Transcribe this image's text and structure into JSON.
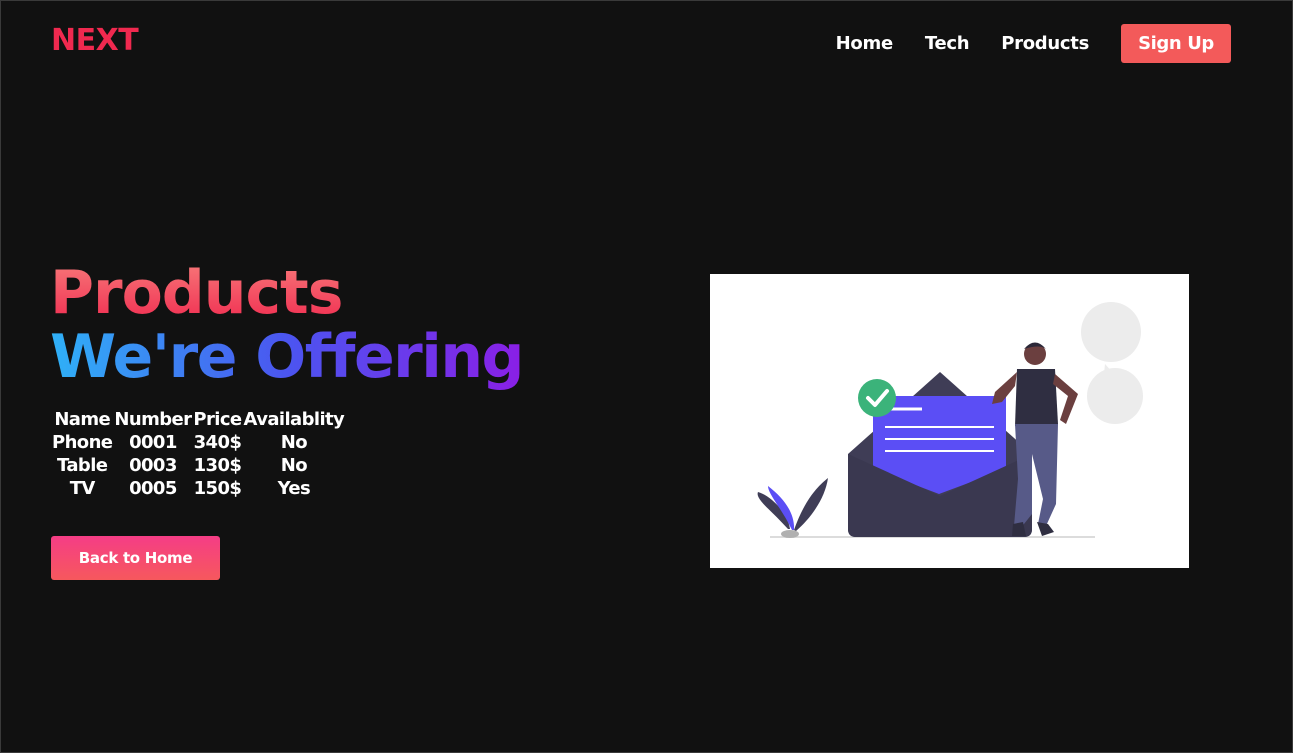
{
  "brand": {
    "logo": "NEXT"
  },
  "nav": {
    "links": [
      "Home",
      "Tech",
      "Products"
    ],
    "cta": "Sign Up"
  },
  "hero": {
    "title_line1": "Products",
    "title_line2": "We're Offering",
    "button": "Back to Home"
  },
  "table": {
    "headers": [
      "Name",
      "Number",
      "Price",
      "Availablity"
    ],
    "rows": [
      [
        "Phone",
        "0001",
        "340$",
        "No"
      ],
      [
        "Table",
        "0003",
        "130$",
        "No"
      ],
      [
        "TV",
        "0005",
        "150$",
        "Yes"
      ]
    ]
  },
  "colors": {
    "background": "#111111",
    "brand": "#f0294f",
    "cta": "#f35a5a",
    "illustration_accent": "#5b4ef5"
  },
  "icons": [
    "check-circle-icon",
    "envelope-icon",
    "leaf-icon"
  ]
}
